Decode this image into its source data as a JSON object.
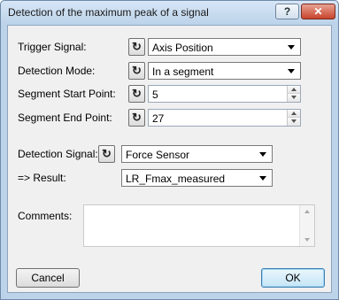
{
  "window": {
    "title": "Detection of the maximum peak of a signal",
    "help_label": "?",
    "close_label": "✕"
  },
  "trigger_signal": {
    "label": "Trigger Signal:",
    "value": "Axis Position",
    "icon": "refresh-icon"
  },
  "detection_mode": {
    "label": "Detection Mode:",
    "value": "In a segment",
    "icon": "refresh-icon"
  },
  "segment_start": {
    "label": "Segment Start Point:",
    "value": "5",
    "icon": "refresh-icon"
  },
  "segment_end": {
    "label": "Segment End Point:",
    "value": "27",
    "icon": "refresh-icon"
  },
  "detection_signal": {
    "label": "Detection Signal:",
    "value": "Force Sensor",
    "icon": "refresh-icon"
  },
  "result": {
    "label": "=> Result:",
    "value": "LR_Fmax_measured"
  },
  "comments": {
    "label": "Comments:",
    "value": ""
  },
  "buttons": {
    "cancel": "Cancel",
    "ok": "OK"
  },
  "icons": {
    "refresh_glyph": "↻"
  }
}
